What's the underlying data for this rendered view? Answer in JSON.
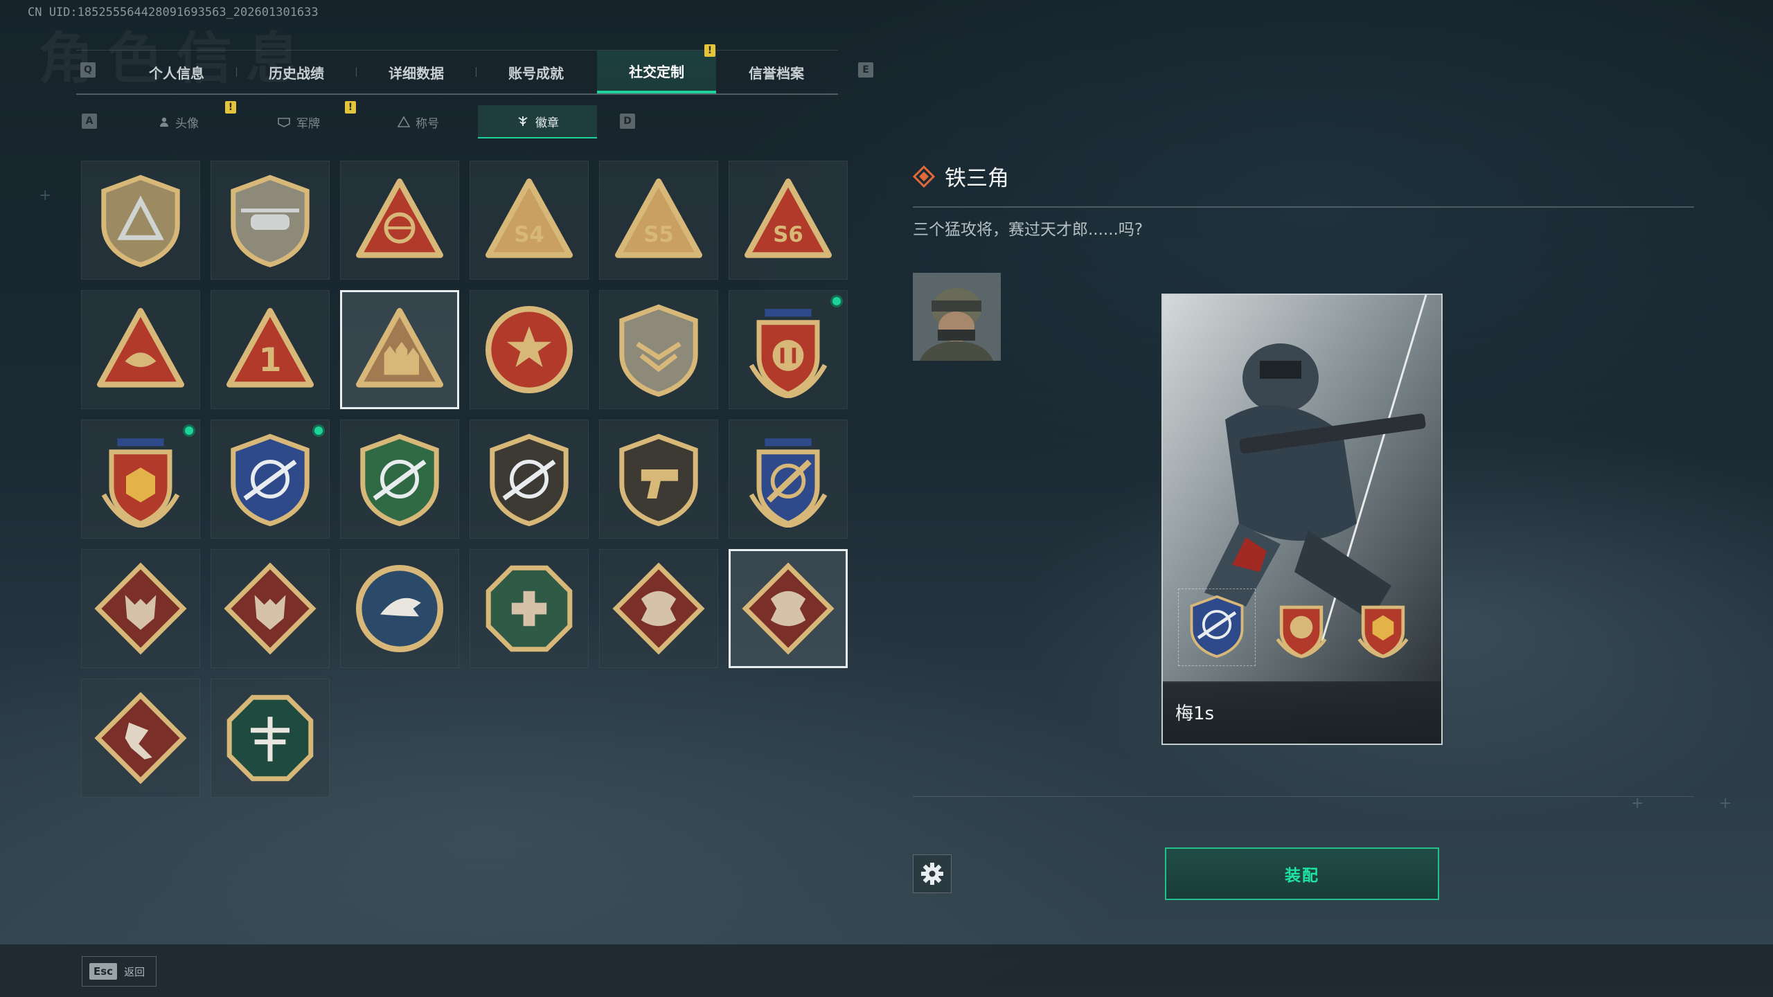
{
  "uid": "CN UID:18525556442809169356​3_202601301633",
  "background_title": "角色信息",
  "tabs": {
    "left_key": "Q",
    "right_key": "E",
    "items": [
      {
        "label": "个人信息"
      },
      {
        "label": "历史战绩"
      },
      {
        "label": "详细数据"
      },
      {
        "label": "账号成就"
      },
      {
        "label": "社交定制",
        "active": true
      },
      {
        "label": "信誉档案"
      }
    ]
  },
  "subtabs": {
    "left_key": "A",
    "right_key": "D",
    "items": [
      {
        "label": "头像"
      },
      {
        "label": "军牌"
      },
      {
        "label": "称号"
      },
      {
        "label": "徽章",
        "active": true
      }
    ]
  },
  "alert_mark": "!",
  "badges": [
    {
      "name": "badge-triangle-shield",
      "shape": "shield",
      "color": "#9b8a62",
      "symbol": "triangle"
    },
    {
      "name": "badge-helicopter",
      "shape": "shield",
      "color": "#8e8a7a",
      "symbol": "heli"
    },
    {
      "name": "badge-globe-triangle",
      "shape": "triangle",
      "color": "#b23a2a",
      "symbol": "globe"
    },
    {
      "name": "badge-s4",
      "shape": "triangle",
      "color": "#c9a061",
      "text": "S4"
    },
    {
      "name": "badge-s5",
      "shape": "triangle",
      "color": "#c9a061",
      "text": "S5"
    },
    {
      "name": "badge-s6",
      "shape": "triangle",
      "color": "#b23a2a",
      "text": "S6"
    },
    {
      "name": "badge-hands-triangle",
      "shape": "triangle",
      "color": "#b23a2a",
      "symbol": "hands"
    },
    {
      "name": "badge-number-one",
      "shape": "triangle",
      "color": "#b23a2a",
      "text": "1"
    },
    {
      "name": "badge-squad",
      "shape": "triangle",
      "color": "#a27a52",
      "symbol": "squad",
      "selected": true
    },
    {
      "name": "badge-star-medal",
      "shape": "circle",
      "color": "#b23a2a",
      "symbol": "star"
    },
    {
      "name": "badge-wings-shield",
      "shape": "shield",
      "color": "#8e8a7a",
      "symbol": "wings"
    },
    {
      "name": "badge-crest-gold",
      "shape": "crest",
      "color": "#b23a2a",
      "symbol": "crest",
      "new": true
    },
    {
      "name": "badge-crest-hex",
      "shape": "crest",
      "color": "#b23a2a",
      "symbol": "hex",
      "new": true
    },
    {
      "name": "badge-sniper-blue",
      "shape": "shield",
      "color": "#2e4a8a",
      "symbol": "scope",
      "new": true
    },
    {
      "name": "badge-rifle-green",
      "shape": "shield",
      "color": "#2f6a45",
      "symbol": "scope"
    },
    {
      "name": "badge-rifle-dark",
      "shape": "shield",
      "color": "#3d3a33",
      "symbol": "scope"
    },
    {
      "name": "badge-pistol-dark",
      "shape": "shield",
      "color": "#3d3a33",
      "symbol": "pistol"
    },
    {
      "name": "badge-sword-blue",
      "shape": "crest",
      "color": "#2e4a8a",
      "symbol": "sword"
    },
    {
      "name": "badge-wolf-1",
      "shape": "diamond",
      "color": "#7a3028",
      "symbol": "wolf"
    },
    {
      "name": "badge-wolf-2",
      "shape": "diamond",
      "color": "#7a3028",
      "symbol": "wolf"
    },
    {
      "name": "badge-eagle",
      "shape": "circle",
      "color": "#2b4a6a",
      "symbol": "eagle"
    },
    {
      "name": "badge-medic",
      "shape": "octagon",
      "color": "#2f5a45",
      "symbol": "cross"
    },
    {
      "name": "badge-dragon-1",
      "shape": "diamond",
      "color": "#7a3028",
      "symbol": "dragon"
    },
    {
      "name": "badge-dragon-2",
      "shape": "diamond",
      "color": "#7a3028",
      "symbol": "dragon",
      "selected": true
    },
    {
      "name": "badge-runner",
      "shape": "diamond",
      "color": "#7a3028",
      "symbol": "runner"
    },
    {
      "name": "badge-dragonfly",
      "shape": "octagon",
      "color": "#1f4a40",
      "symbol": "dragonfly"
    }
  ],
  "detail": {
    "title": "铁三角",
    "description": "三个猛攻将，赛过天才郎......吗?",
    "card_player_name": "梅1s",
    "equip_label": "装配"
  },
  "footer": {
    "esc_key": "Esc",
    "back_label": "返回"
  },
  "colors": {
    "accent": "#1fd49a",
    "alert": "#e3c43b",
    "badge_gold": "#d8b878"
  }
}
